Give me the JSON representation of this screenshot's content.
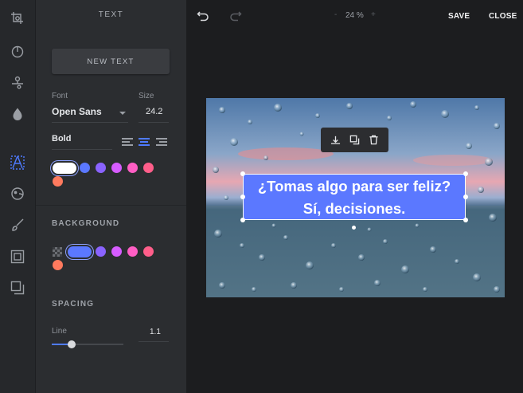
{
  "panel": {
    "title": "TEXT",
    "new_text_label": "NEW TEXT",
    "font_label": "Font",
    "font_value": "Open Sans",
    "size_label": "Size",
    "size_value": "24.2",
    "weight_value": "Bold",
    "alignment_options": [
      "align-left",
      "align-center",
      "align-right"
    ],
    "alignment_selected": "align-center",
    "text_colors": [
      "#ffffff",
      "#5b78ff",
      "#8a63ff",
      "#d65cff",
      "#ff5ec4",
      "#ff5e8a",
      "#ff7a5e"
    ],
    "text_color_selected": "#ffffff",
    "background_title": "BACKGROUND",
    "background_colors": [
      "transparent",
      "#5b78ff",
      "#8a63ff",
      "#d65cff",
      "#ff5ec4",
      "#ff5e8a",
      "#ff7a5e"
    ],
    "background_color_selected": "#5b78ff",
    "spacing_title": "SPACING",
    "line_label": "Line",
    "line_value": "1.1",
    "line_slider_fraction": 0.27
  },
  "rail": {
    "icons": [
      "crop-icon",
      "filters-icon",
      "adjust-icon",
      "focus-icon",
      "text-icon",
      "stickers-icon",
      "brush-icon",
      "frame-icon",
      "overlay-icon"
    ],
    "active": "text-icon"
  },
  "topbar": {
    "undo_icon": "undo-icon",
    "redo_icon": "redo-icon",
    "zoom_value": "24 %",
    "zoom_out": "-",
    "zoom_in": "+",
    "save_label": "SAVE",
    "close_label": "CLOSE"
  },
  "canvas": {
    "text_line1": "¿Tomas algo para ser feliz?",
    "text_line2": "Sí, decisiones.",
    "toolbar_icons": [
      "align-bottom-icon",
      "bring-to-front-icon",
      "delete-icon"
    ]
  },
  "colors": {
    "accent": "#4f7bff",
    "textbox_bg": "#5b78ff",
    "panel_bg": "#2b2d30",
    "app_bg": "#1c1d1f"
  }
}
